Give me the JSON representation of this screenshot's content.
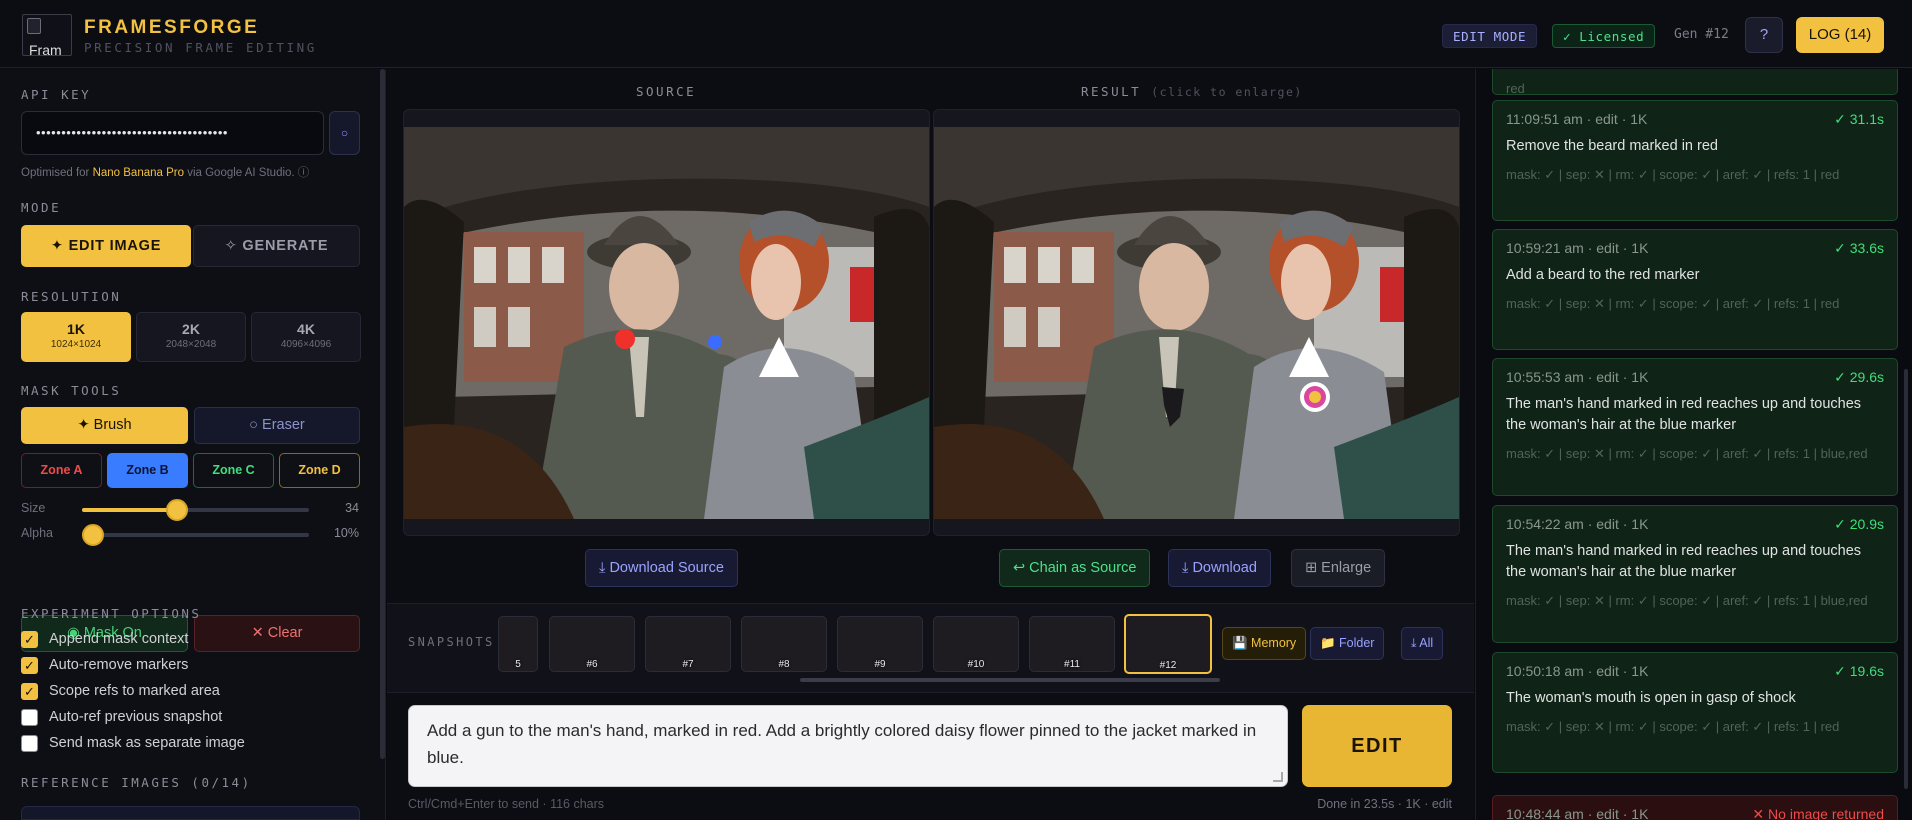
{
  "header": {
    "logo_alt": "Fram",
    "brand_title": "FRAMESFORGE",
    "brand_subtitle": "PRECISION FRAME EDITING",
    "mode_badge": "EDIT MODE",
    "licensed_badge": "✓ Licensed",
    "gen_label": "Gen #12",
    "help_label": "?",
    "log_button": "LOG (14)"
  },
  "sidebar": {
    "api_key_label": "API KEY",
    "api_key_value": "••••••••••••••••••••••••••••••••••••••",
    "eye_icon": "○",
    "note_prefix": "Optimised for ",
    "note_model": "Nano Banana Pro",
    "note_suffix": " via Google AI Studio. ⓘ",
    "mode_label": "MODE",
    "mode_edit": "✦ EDIT IMAGE",
    "mode_generate": "✧ GENERATE",
    "resolution_label": "RESOLUTION",
    "resolutions": [
      {
        "name": "1K",
        "size": "1024×1024"
      },
      {
        "name": "2K",
        "size": "2048×2048"
      },
      {
        "name": "4K",
        "size": "4096×4096"
      }
    ],
    "mask_tools_label": "MASK TOOLS",
    "brush_label": "✦ Brush",
    "eraser_label": "○ Eraser",
    "zones": [
      "Zone A",
      "Zone B",
      "Zone C",
      "Zone D"
    ],
    "size_label": "Size",
    "size_value": "34",
    "size_fraction": 0.42,
    "alpha_label": "Alpha",
    "alpha_value": "10%",
    "alpha_fraction": 0.05,
    "mask_on_label": "◉ Mask On",
    "clear_label": "✕ Clear",
    "experiment_label": "EXPERIMENT OPTIONS",
    "options": [
      {
        "label": "Append mask context",
        "checked": true
      },
      {
        "label": "Auto-remove markers",
        "checked": true
      },
      {
        "label": "Scope refs to marked area",
        "checked": true
      },
      {
        "label": "Auto-ref previous snapshot",
        "checked": false
      },
      {
        "label": "Send mask as separate image",
        "checked": false
      }
    ],
    "reference_label": "REFERENCE IMAGES (0/14)"
  },
  "workspace": {
    "source_label": "SOURCE",
    "result_label": "RESULT",
    "result_hint": "(click to enlarge)",
    "download_source": "⤓ Download Source",
    "chain_source": "↩ Chain as Source",
    "download": "⤓ Download",
    "enlarge": "⊞ Enlarge"
  },
  "snapshots": {
    "label": "SNAPSHOTS",
    "items": [
      "5",
      "#6",
      "#7",
      "#8",
      "#9",
      "#10",
      "#11",
      "#12"
    ],
    "selected": "#12",
    "memory_button": "💾 Memory",
    "folder_button": "📁 Folder",
    "all_button": "⤓ All"
  },
  "prompt": {
    "text": "Add a gun to the man's hand, marked in red. Add a brightly colored daisy flower pinned to the jacket marked in blue.",
    "edit_button": "EDIT",
    "shortcut_hint": "Ctrl/Cmd+Enter to send · 116 chars",
    "status": "Done in 23.5s · 1K · edit"
  },
  "log": {
    "top_fragment": "red",
    "entries": [
      {
        "meta": "11:09:51 am · edit · 1K",
        "time": "✓ 31.1s",
        "message": "Remove the beard marked in red",
        "detail": "mask: ✓ | sep: ✕ | rm: ✓ | scope: ✓ | aref: ✓ | refs: 1 | red"
      },
      {
        "meta": "10:59:21 am · edit · 1K",
        "time": "✓ 33.6s",
        "message": "Add a beard to the red marker",
        "detail": "mask: ✓ | sep: ✕ | rm: ✓ | scope: ✓ | aref: ✓ | refs: 1 | red"
      },
      {
        "meta": "10:55:53 am · edit · 1K",
        "time": "✓ 29.6s",
        "message": "The man's hand marked in red reaches up and touches the woman's hair at the blue marker",
        "detail": "mask: ✓ | sep: ✕ | rm: ✓ | scope: ✓ | aref: ✓ | refs: 1 | blue,red"
      },
      {
        "meta": "10:54:22 am · edit · 1K",
        "time": "✓ 20.9s",
        "message": "The man's hand marked in red reaches up and touches the woman's hair at the blue marker",
        "detail": "mask: ✓ | sep: ✕ | rm: ✓ | scope: ✓ | aref: ✓ | refs: 1 | blue,red"
      },
      {
        "meta": "10:50:18 am · edit · 1K",
        "time": "✓ 19.6s",
        "message": "The woman's mouth is open in gasp of shock",
        "detail": "mask: ✓ | sep: ✕ | rm: ✓ | scope: ✓ | aref: ✓ | refs: 1 | red"
      },
      {
        "meta": "10:48:44 am · edit · 1K",
        "time": "✕ No image returned",
        "message": "",
        "detail": "",
        "error": true
      }
    ]
  },
  "colors": {
    "accent": "#f2c13f",
    "success": "#3fdf7a",
    "error": "#f04a4a",
    "zone_b": "#3a7cff",
    "background": "#0a0b10"
  }
}
